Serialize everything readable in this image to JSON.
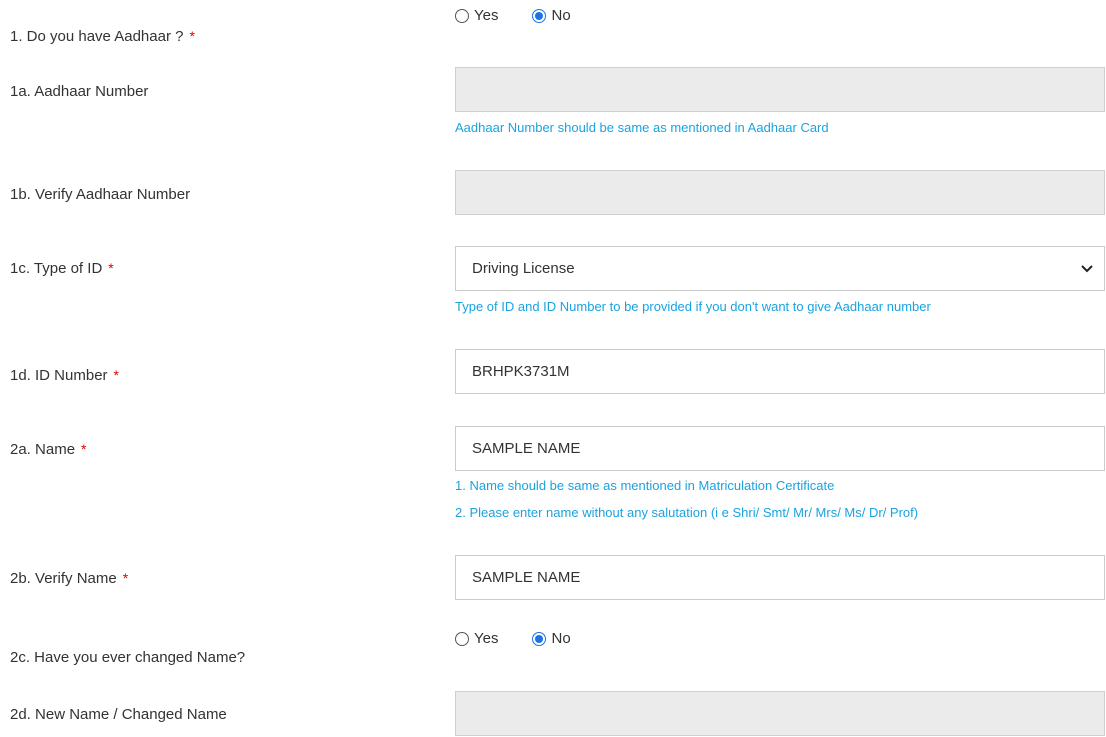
{
  "q1": {
    "label": "1. Do you have Aadhaar ?",
    "required": "*",
    "options": [
      "Yes",
      "No"
    ],
    "selected": "No"
  },
  "q1a": {
    "label": "1a. Aadhaar Number",
    "value": "",
    "hint": "Aadhaar Number should be same as mentioned in Aadhaar Card"
  },
  "q1b": {
    "label": "1b. Verify Aadhaar Number",
    "value": ""
  },
  "q1c": {
    "label": "1c. Type of ID",
    "required": "*",
    "value": "Driving License",
    "hint": "Type of ID and ID Number to be provided if you don't want to give Aadhaar number"
  },
  "q1d": {
    "label": "1d. ID Number",
    "required": "*",
    "value": "BRHPK3731M"
  },
  "q2a": {
    "label": "2a. Name",
    "required": "*",
    "value": "SAMPLE NAME",
    "hint1": "1. Name should be same as mentioned in Matriculation Certificate",
    "hint2": "2. Please enter name without any salutation (i e Shri/ Smt/ Mr/ Mrs/ Ms/ Dr/ Prof)"
  },
  "q2b": {
    "label": "2b. Verify Name",
    "required": "*",
    "value": "SAMPLE NAME"
  },
  "q2c": {
    "label": "2c. Have you ever changed Name?",
    "options": [
      "Yes",
      "No"
    ],
    "selected": "No"
  },
  "q2d": {
    "label": "2d. New Name / Changed Name",
    "value": ""
  },
  "colors": {
    "hint": "#1aa3e0",
    "required": "#e00000",
    "radio_checked": "#1a73e8",
    "disabled_bg": "#ebebeb"
  }
}
